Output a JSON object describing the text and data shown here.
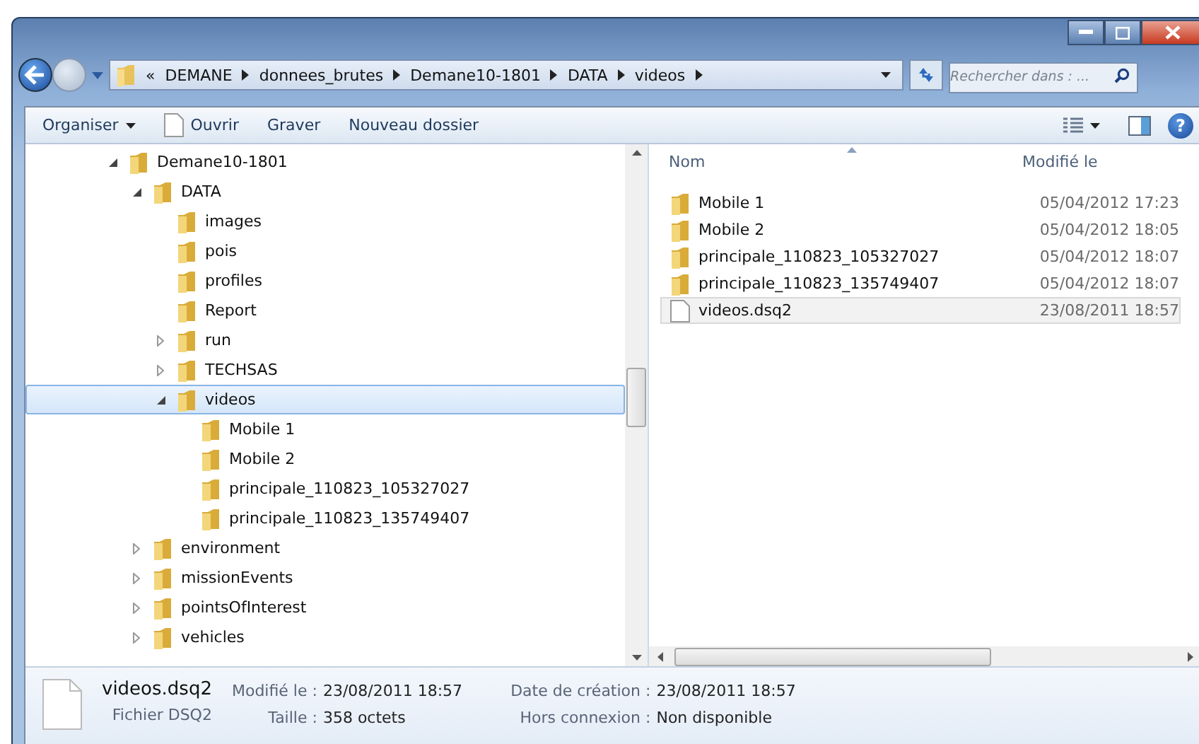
{
  "address": {
    "overflow": "«",
    "crumbs": [
      "DEMANE",
      "donnees_brutes",
      "Demane10-1801",
      "DATA",
      "videos"
    ]
  },
  "search": {
    "placeholder": "Rechercher dans : ..."
  },
  "toolbar": {
    "organize": "Organiser",
    "open": "Ouvrir",
    "burn": "Graver",
    "new_folder": "Nouveau dossier",
    "help": "?"
  },
  "tree": [
    {
      "label": "Demane10-1801",
      "expanded": true,
      "selected": false,
      "children": [
        {
          "label": "DATA",
          "expanded": true,
          "selected": false,
          "children": [
            {
              "label": "images",
              "selected": false
            },
            {
              "label": "pois",
              "selected": false
            },
            {
              "label": "profiles",
              "selected": false
            },
            {
              "label": "Report",
              "selected": false
            },
            {
              "label": "run",
              "expanded": false,
              "selected": false
            },
            {
              "label": "TECHSAS",
              "expanded": false,
              "selected": false
            },
            {
              "label": "videos",
              "expanded": true,
              "selected": true,
              "children": [
                {
                  "label": "Mobile 1",
                  "selected": false
                },
                {
                  "label": "Mobile 2",
                  "selected": false
                },
                {
                  "label": "principale_110823_105327027",
                  "selected": false
                },
                {
                  "label": "principale_110823_135749407",
                  "selected": false
                }
              ]
            }
          ]
        },
        {
          "label": "environment",
          "expanded": false,
          "selected": false
        },
        {
          "label": "missionEvents",
          "expanded": false,
          "selected": false
        },
        {
          "label": "pointsOfInterest",
          "expanded": false,
          "selected": false
        },
        {
          "label": "vehicles",
          "expanded": false,
          "selected": false
        }
      ]
    }
  ],
  "columns": [
    "Nom",
    "Modifié le"
  ],
  "files": [
    {
      "kind": "folder",
      "name": "Mobile 1",
      "modified": "05/04/2012 17:23",
      "selected": false
    },
    {
      "kind": "folder",
      "name": "Mobile 2",
      "modified": "05/04/2012 18:05",
      "selected": false
    },
    {
      "kind": "folder",
      "name": "principale_110823_105327027",
      "modified": "05/04/2012 18:07",
      "selected": false
    },
    {
      "kind": "folder",
      "name": "principale_110823_135749407",
      "modified": "05/04/2012 18:07",
      "selected": false
    },
    {
      "kind": "file",
      "name": "videos.dsq2",
      "modified": "23/08/2011 18:57",
      "selected": true
    }
  ],
  "details": {
    "name": "videos.dsq2",
    "type": "Fichier DSQ2",
    "fields": [
      {
        "label": "Modifié le :",
        "value": "23/08/2011 18:57"
      },
      {
        "label": "Taille :",
        "value": "358 octets"
      },
      {
        "label": "Date de création :",
        "value": "23/08/2011 18:57"
      },
      {
        "label": "Hors connexion :",
        "value": "Non disponible"
      }
    ]
  }
}
